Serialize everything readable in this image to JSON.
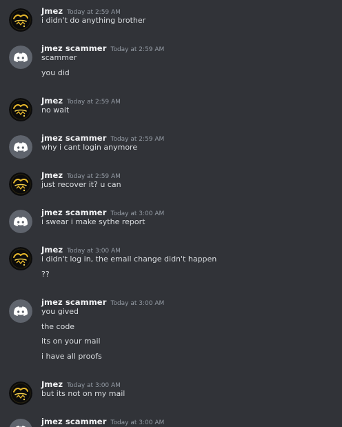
{
  "messages": [
    {
      "author": "Jmez",
      "avatar": "jmez-logo-icon",
      "timestamp": "Today at 2:59 AM",
      "lines": [
        "i didn't do anything brother"
      ]
    },
    {
      "author": "jmez scammer",
      "avatar": "discord-default-avatar-icon",
      "timestamp": "Today at 2:59 AM",
      "lines": [
        "scammer",
        "you did"
      ]
    },
    {
      "author": "Jmez",
      "avatar": "jmez-logo-icon",
      "timestamp": "Today at 2:59 AM",
      "lines": [
        "no wait"
      ]
    },
    {
      "author": "jmez scammer",
      "avatar": "discord-default-avatar-icon",
      "timestamp": "Today at 2:59 AM",
      "lines": [
        "why i cant login anymore"
      ]
    },
    {
      "author": "Jmez",
      "avatar": "jmez-logo-icon",
      "timestamp": "Today at 2:59 AM",
      "lines": [
        "just recover it? u can"
      ]
    },
    {
      "author": "jmez scammer",
      "avatar": "discord-default-avatar-icon",
      "timestamp": "Today at 3:00 AM",
      "lines": [
        "i swear i make sythe report"
      ]
    },
    {
      "author": "Jmez",
      "avatar": "jmez-logo-icon",
      "timestamp": "Today at 3:00 AM",
      "lines": [
        "i didn't log in, the email change didn't happen",
        "??"
      ]
    },
    {
      "author": "jmez scammer",
      "avatar": "discord-default-avatar-icon",
      "timestamp": "Today at 3:00 AM",
      "lines": [
        "you gived",
        "the code",
        "its on your mail",
        "i have all proofs"
      ]
    },
    {
      "author": "Jmez",
      "avatar": "jmez-logo-icon",
      "timestamp": "Today at 3:00 AM",
      "lines": [
        "but its not on my mail"
      ]
    },
    {
      "author": "jmez scammer",
      "avatar": "discord-default-avatar-icon",
      "timestamp": "Today at 3:00 AM",
      "lines": []
    }
  ],
  "colors": {
    "background": "#313338",
    "author": "#f2f3f5",
    "timestamp": "#949ba4",
    "text": "#dbdee1",
    "discord_avatar_bg": "#5f646d",
    "jmez_logo_gold": "#e5b62a"
  }
}
